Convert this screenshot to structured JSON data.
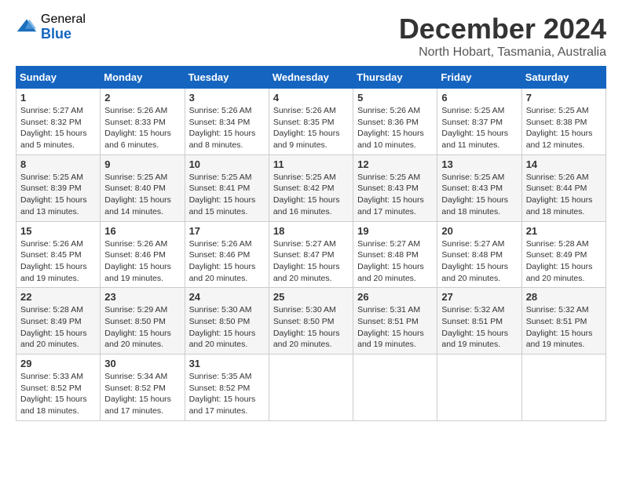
{
  "header": {
    "logo_general": "General",
    "logo_blue": "Blue",
    "title": "December 2024",
    "subtitle": "North Hobart, Tasmania, Australia"
  },
  "days_of_week": [
    "Sunday",
    "Monday",
    "Tuesday",
    "Wednesday",
    "Thursday",
    "Friday",
    "Saturday"
  ],
  "weeks": [
    [
      {
        "day": "1",
        "sunrise": "5:27 AM",
        "sunset": "8:32 PM",
        "daylight": "15 hours and 5 minutes."
      },
      {
        "day": "2",
        "sunrise": "5:26 AM",
        "sunset": "8:33 PM",
        "daylight": "15 hours and 6 minutes."
      },
      {
        "day": "3",
        "sunrise": "5:26 AM",
        "sunset": "8:34 PM",
        "daylight": "15 hours and 8 minutes."
      },
      {
        "day": "4",
        "sunrise": "5:26 AM",
        "sunset": "8:35 PM",
        "daylight": "15 hours and 9 minutes."
      },
      {
        "day": "5",
        "sunrise": "5:26 AM",
        "sunset": "8:36 PM",
        "daylight": "15 hours and 10 minutes."
      },
      {
        "day": "6",
        "sunrise": "5:25 AM",
        "sunset": "8:37 PM",
        "daylight": "15 hours and 11 minutes."
      },
      {
        "day": "7",
        "sunrise": "5:25 AM",
        "sunset": "8:38 PM",
        "daylight": "15 hours and 12 minutes."
      }
    ],
    [
      {
        "day": "8",
        "sunrise": "5:25 AM",
        "sunset": "8:39 PM",
        "daylight": "15 hours and 13 minutes."
      },
      {
        "day": "9",
        "sunrise": "5:25 AM",
        "sunset": "8:40 PM",
        "daylight": "15 hours and 14 minutes."
      },
      {
        "day": "10",
        "sunrise": "5:25 AM",
        "sunset": "8:41 PM",
        "daylight": "15 hours and 15 minutes."
      },
      {
        "day": "11",
        "sunrise": "5:25 AM",
        "sunset": "8:42 PM",
        "daylight": "15 hours and 16 minutes."
      },
      {
        "day": "12",
        "sunrise": "5:25 AM",
        "sunset": "8:43 PM",
        "daylight": "15 hours and 17 minutes."
      },
      {
        "day": "13",
        "sunrise": "5:25 AM",
        "sunset": "8:43 PM",
        "daylight": "15 hours and 18 minutes."
      },
      {
        "day": "14",
        "sunrise": "5:26 AM",
        "sunset": "8:44 PM",
        "daylight": "15 hours and 18 minutes."
      }
    ],
    [
      {
        "day": "15",
        "sunrise": "5:26 AM",
        "sunset": "8:45 PM",
        "daylight": "15 hours and 19 minutes."
      },
      {
        "day": "16",
        "sunrise": "5:26 AM",
        "sunset": "8:46 PM",
        "daylight": "15 hours and 19 minutes."
      },
      {
        "day": "17",
        "sunrise": "5:26 AM",
        "sunset": "8:46 PM",
        "daylight": "15 hours and 20 minutes."
      },
      {
        "day": "18",
        "sunrise": "5:27 AM",
        "sunset": "8:47 PM",
        "daylight": "15 hours and 20 minutes."
      },
      {
        "day": "19",
        "sunrise": "5:27 AM",
        "sunset": "8:48 PM",
        "daylight": "15 hours and 20 minutes."
      },
      {
        "day": "20",
        "sunrise": "5:27 AM",
        "sunset": "8:48 PM",
        "daylight": "15 hours and 20 minutes."
      },
      {
        "day": "21",
        "sunrise": "5:28 AM",
        "sunset": "8:49 PM",
        "daylight": "15 hours and 20 minutes."
      }
    ],
    [
      {
        "day": "22",
        "sunrise": "5:28 AM",
        "sunset": "8:49 PM",
        "daylight": "15 hours and 20 minutes."
      },
      {
        "day": "23",
        "sunrise": "5:29 AM",
        "sunset": "8:50 PM",
        "daylight": "15 hours and 20 minutes."
      },
      {
        "day": "24",
        "sunrise": "5:30 AM",
        "sunset": "8:50 PM",
        "daylight": "15 hours and 20 minutes."
      },
      {
        "day": "25",
        "sunrise": "5:30 AM",
        "sunset": "8:50 PM",
        "daylight": "15 hours and 20 minutes."
      },
      {
        "day": "26",
        "sunrise": "5:31 AM",
        "sunset": "8:51 PM",
        "daylight": "15 hours and 19 minutes."
      },
      {
        "day": "27",
        "sunrise": "5:32 AM",
        "sunset": "8:51 PM",
        "daylight": "15 hours and 19 minutes."
      },
      {
        "day": "28",
        "sunrise": "5:32 AM",
        "sunset": "8:51 PM",
        "daylight": "15 hours and 19 minutes."
      }
    ],
    [
      {
        "day": "29",
        "sunrise": "5:33 AM",
        "sunset": "8:52 PM",
        "daylight": "15 hours and 18 minutes."
      },
      {
        "day": "30",
        "sunrise": "5:34 AM",
        "sunset": "8:52 PM",
        "daylight": "15 hours and 17 minutes."
      },
      {
        "day": "31",
        "sunrise": "5:35 AM",
        "sunset": "8:52 PM",
        "daylight": "15 hours and 17 minutes."
      },
      null,
      null,
      null,
      null
    ]
  ],
  "labels": {
    "sunrise": "Sunrise:",
    "sunset": "Sunset:",
    "daylight": "Daylight:"
  }
}
